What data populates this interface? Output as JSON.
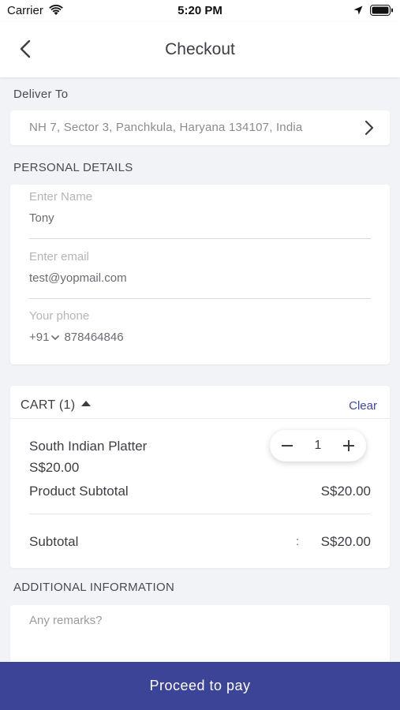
{
  "status_bar": {
    "carrier": "Carrier",
    "time": "5:20 PM"
  },
  "nav": {
    "title": "Checkout",
    "back_icon": "chevron-left-icon"
  },
  "deliver": {
    "label": "Deliver To",
    "address": "NH 7, Sector 3, Panchkula, Haryana 134107, India",
    "chevron_icon": "chevron-right-icon"
  },
  "personal": {
    "label": "PERSONAL DETAILS",
    "name": {
      "placeholder": "Enter Name",
      "value": "Tony"
    },
    "email": {
      "placeholder": "Enter email",
      "value": "test@yopmail.com"
    },
    "phone": {
      "placeholder": "Your phone",
      "code": "+91",
      "value": "878464846"
    }
  },
  "cart": {
    "label": "CART (1)",
    "clear_label": "Clear",
    "items": [
      {
        "name": "South Indian Platter",
        "price": "S$20.00",
        "quantity": "1"
      }
    ],
    "product_subtotal_label": "Product Subtotal",
    "product_subtotal_value": "S$20.00",
    "subtotal_label": "Subtotal",
    "subtotal_colon": ":",
    "subtotal_value": "S$20.00"
  },
  "additional": {
    "label": "ADDITIONAL INFORMATION",
    "remarks_placeholder": "Any remarks?"
  },
  "footer": {
    "proceed_label": "Proceed to pay"
  },
  "colors": {
    "accent": "#3b4496",
    "clear_link": "#3d4a9a",
    "background": "#f2f3f6"
  }
}
